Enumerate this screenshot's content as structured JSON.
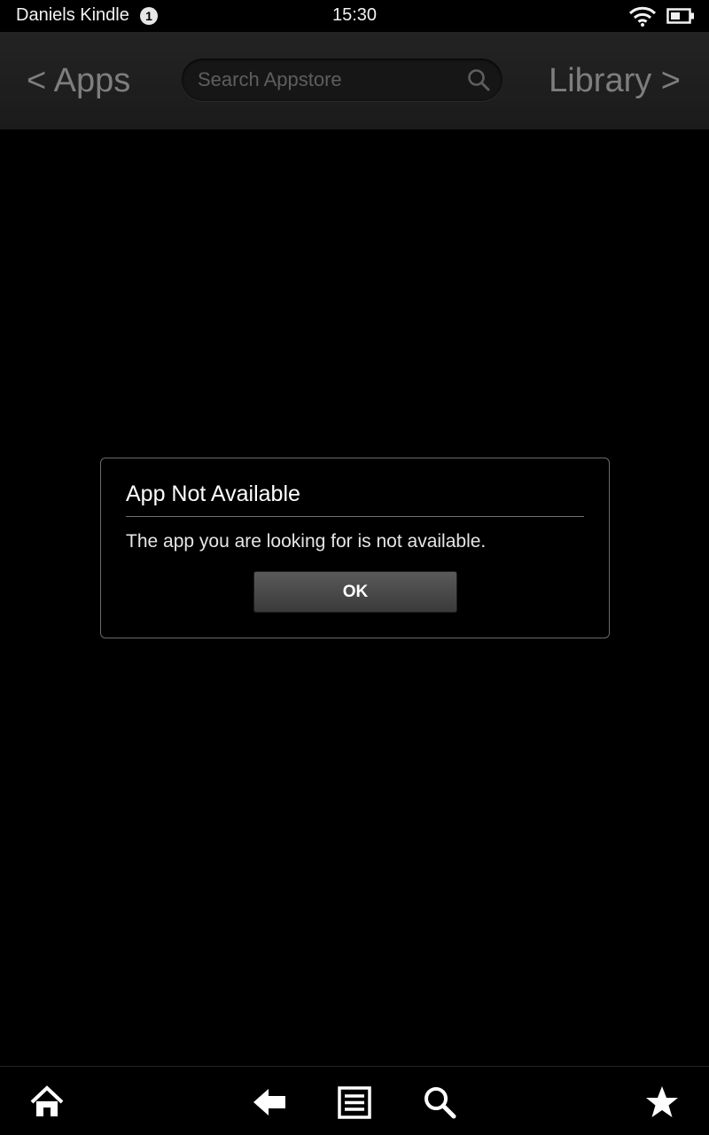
{
  "status_bar": {
    "device_name": "Daniels Kindle",
    "notification_count": "1",
    "time": "15:30",
    "wifi_icon": "wifi-icon",
    "battery_icon": "battery-icon"
  },
  "nav": {
    "back_label": "< Apps",
    "forward_label": "Library >",
    "search_placeholder": "Search Appstore",
    "search_icon": "search-icon"
  },
  "dialog": {
    "title": "App Not Available",
    "message": "The app you are looking for is not available.",
    "ok_label": "OK"
  },
  "bottom_bar": {
    "items": [
      {
        "name": "home",
        "icon": "home-icon"
      },
      {
        "name": "back",
        "icon": "back-arrow-icon"
      },
      {
        "name": "menu",
        "icon": "menu-icon"
      },
      {
        "name": "search",
        "icon": "search-icon"
      },
      {
        "name": "favorites",
        "icon": "star-icon"
      }
    ]
  },
  "colors": {
    "background": "#000000",
    "nav_text": "#7e7e7e",
    "dialog_border": "#6b6b6b",
    "button_top": "#5a5a5a",
    "button_bottom": "#3a3a3a"
  }
}
